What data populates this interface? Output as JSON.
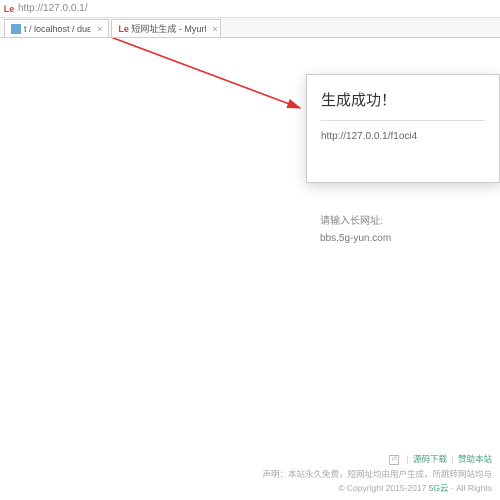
{
  "browser": {
    "favicon_label": "Le",
    "url": "http://127.0.0.1/",
    "tabs": [
      {
        "label": "t / localhost / duε",
        "close": "×"
      },
      {
        "label": "短网址生成 - Myurl",
        "close": "×"
      }
    ]
  },
  "dialog": {
    "title": "生成成功！",
    "short_url": "http://127.0.0.1/f1oci4"
  },
  "form": {
    "label": "请输入长网址:",
    "value": "bbs.5g-yun.com"
  },
  "footer": {
    "icon_glyph": "⇄",
    "link1": "源码下载",
    "link2": "赞助本站",
    "disclaimer": "声明：本站永久免费，短网址均由用户生成，所跳转网站均与",
    "copyright_prefix": "© Copyright 2015-2017 ",
    "copyright_brand": "5G云",
    "copyright_suffix": " - All Rights"
  }
}
